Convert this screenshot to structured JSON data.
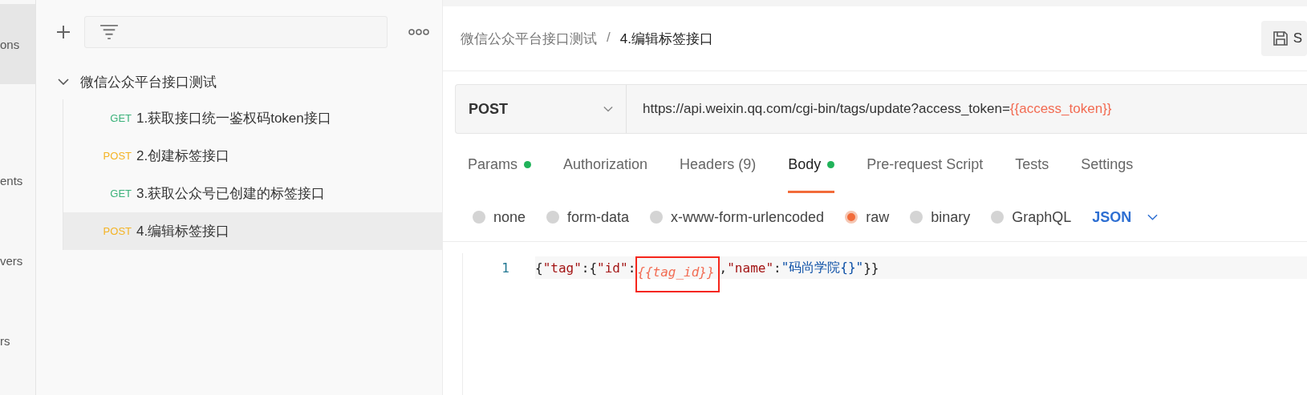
{
  "rail": {
    "items": [
      {
        "label": "ons",
        "selected": true
      },
      {
        "label": "ents",
        "selected": false
      },
      {
        "label": "vers",
        "selected": false
      },
      {
        "label": "rs",
        "selected": false
      }
    ]
  },
  "sidebar": {
    "collection": {
      "name": "微信公众平台接口测试",
      "expanded": true,
      "children": [
        {
          "method": "GET",
          "name": "1.获取接口统一鉴权码token接口",
          "selected": false
        },
        {
          "method": "POST",
          "name": "2.创建标签接口",
          "selected": false
        },
        {
          "method": "GET",
          "name": "3.获取公众号已创建的标签接口",
          "selected": false
        },
        {
          "method": "POST",
          "name": "4.编辑标签接口",
          "selected": true
        }
      ]
    }
  },
  "breadcrumb": {
    "parent": "微信公众平台接口测试",
    "separator": "/",
    "current": "4.编辑标签接口"
  },
  "save_button": {
    "label": "S"
  },
  "request": {
    "method": "POST",
    "url": "https://api.weixin.qq.com/cgi-bin/tags/update?access_token=",
    "url_variable": "{{access_token}}"
  },
  "tabs": [
    {
      "label": "Params",
      "dot": true,
      "selected": false
    },
    {
      "label": "Authorization",
      "dot": false,
      "selected": false
    },
    {
      "label": "Headers (9)",
      "dot": false,
      "selected": false
    },
    {
      "label": "Body",
      "dot": true,
      "selected": true
    },
    {
      "label": "Pre-request Script",
      "dot": false,
      "selected": false
    },
    {
      "label": "Tests",
      "dot": false,
      "selected": false
    },
    {
      "label": "Settings",
      "dot": false,
      "selected": false
    }
  ],
  "body_types": [
    {
      "label": "none",
      "selected": false
    },
    {
      "label": "form-data",
      "selected": false
    },
    {
      "label": "x-www-form-urlencoded",
      "selected": false
    },
    {
      "label": "raw",
      "selected": true
    },
    {
      "label": "binary",
      "selected": false
    },
    {
      "label": "GraphQL",
      "selected": false
    }
  ],
  "format": "JSON",
  "editor": {
    "lines": [
      {
        "number": "1",
        "tokens": [
          {
            "text": "{",
            "kind": "punct"
          },
          {
            "text": "\"tag\"",
            "kind": "key"
          },
          {
            "text": ":",
            "kind": "punct"
          },
          {
            "text": "{",
            "kind": "punct"
          },
          {
            "text": "\"id\"",
            "kind": "key"
          },
          {
            "text": ":",
            "kind": "punct"
          },
          {
            "text": "{{tag_id}}",
            "kind": "variable",
            "boxed": true
          },
          {
            "text": ",",
            "kind": "punct"
          },
          {
            "text": "\"name\"",
            "kind": "key"
          },
          {
            "text": ":",
            "kind": "punct"
          },
          {
            "text": "\"码尚学院{}\"",
            "kind": "string"
          },
          {
            "text": "}}",
            "kind": "punct"
          }
        ]
      }
    ]
  }
}
